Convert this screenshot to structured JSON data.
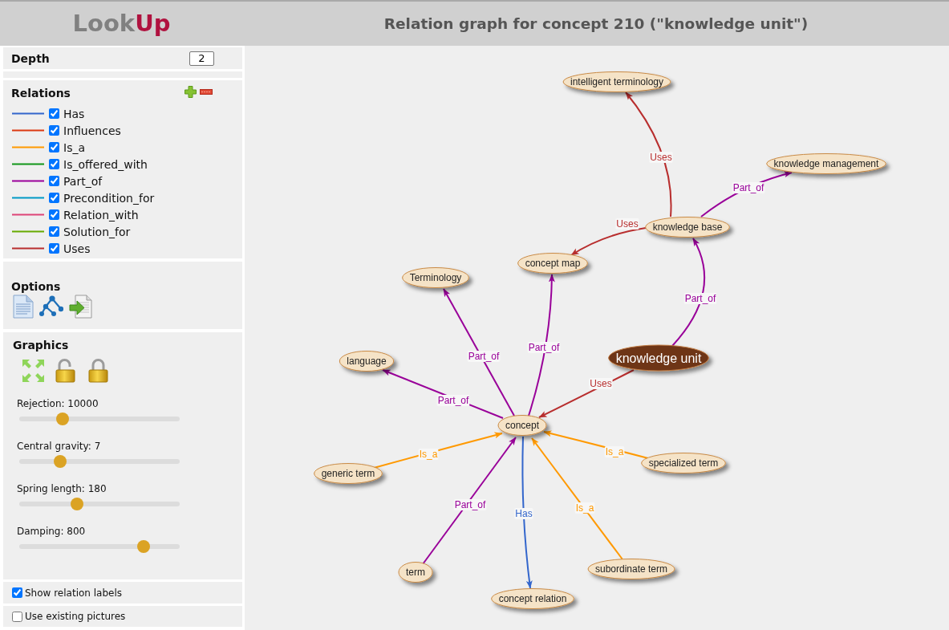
{
  "header": {
    "logo": [
      {
        "text": "Look",
        "kind": "plain"
      },
      {
        "text": "Up",
        "kind": "accent"
      }
    ],
    "title": "Relation graph for concept 210 (\"knowledge unit\")"
  },
  "sidebar": {
    "depth": {
      "label": "Depth",
      "value": "2"
    },
    "relations": {
      "title": "Relations",
      "items": [
        {
          "label": "Has",
          "checked": true,
          "color": "#3366cc"
        },
        {
          "label": "Influences",
          "checked": true,
          "color": "#dc3912"
        },
        {
          "label": "Is_a",
          "checked": true,
          "color": "#ff9900"
        },
        {
          "label": "Is_offered_with",
          "checked": true,
          "color": "#109618"
        },
        {
          "label": "Part_of",
          "checked": true,
          "color": "#990099"
        },
        {
          "label": "Precondition_for",
          "checked": true,
          "color": "#0099c6"
        },
        {
          "label": "Relation_with",
          "checked": true,
          "color": "#dd4477"
        },
        {
          "label": "Solution_for",
          "checked": true,
          "color": "#66aa00"
        },
        {
          "label": "Uses",
          "checked": true,
          "color": "#b82e2e"
        }
      ]
    },
    "options": {
      "title": "Options"
    },
    "graphics": {
      "title": "Graphics",
      "sliders": [
        {
          "label": "Rejection: 10000",
          "level": 0.27
        },
        {
          "label": "Central gravity: 7",
          "level": 0.255
        },
        {
          "label": "Spring length: 180",
          "level": 0.36
        },
        {
          "label": "Damping: 800",
          "level": 0.775
        }
      ]
    },
    "show_relation_labels": {
      "label": "Show relation labels",
      "checked": true
    },
    "use_existing_pictures": {
      "label": "Use existing pictures",
      "checked": false
    }
  },
  "graph": {
    "nodes": [
      {
        "label": "intelligent terminology",
        "kind": "concept"
      },
      {
        "label": "knowledge management",
        "kind": "concept"
      },
      {
        "label": "knowledge base",
        "kind": "concept"
      },
      {
        "label": "Terminology",
        "kind": "concept"
      },
      {
        "label": "concept map",
        "kind": "concept"
      },
      {
        "label": "language",
        "kind": "concept"
      },
      {
        "label": "knowledge unit",
        "kind": "focus"
      },
      {
        "label": "concept",
        "kind": "concept"
      },
      {
        "label": "generic term",
        "kind": "concept"
      },
      {
        "label": "specialized term",
        "kind": "concept"
      },
      {
        "label": "term",
        "kind": "concept"
      },
      {
        "label": "subordinate term",
        "kind": "concept"
      },
      {
        "label": "concept relation",
        "kind": "concept"
      }
    ],
    "edges": [
      {
        "label": "Uses",
        "color": "#b82e2e"
      },
      {
        "label": "Part_of",
        "color": "#990099"
      },
      {
        "label": "Uses",
        "color": "#b82e2e"
      },
      {
        "label": "Part_of",
        "color": "#990099"
      },
      {
        "label": "Part_of",
        "color": "#990099"
      },
      {
        "label": "Part_of",
        "color": "#990099"
      },
      {
        "label": "Uses",
        "color": "#b82e2e"
      },
      {
        "label": "Part_of",
        "color": "#990099"
      },
      {
        "label": "Is_a",
        "color": "#ff9900"
      },
      {
        "label": "Is_a",
        "color": "#ff9900"
      },
      {
        "label": "Part_of",
        "color": "#990099"
      },
      {
        "label": "Has",
        "color": "#3366cc"
      },
      {
        "label": "Is_a",
        "color": "#ff9900"
      }
    ]
  }
}
